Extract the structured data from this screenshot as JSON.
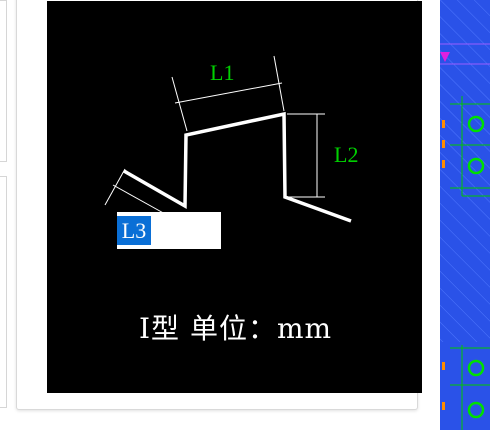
{
  "preview": {
    "dimension_labels": {
      "l1": "L1",
      "l2": "L2",
      "l3": "L3"
    },
    "caption": "I型 单位：mm"
  },
  "colors": {
    "canvas_background": "#000000",
    "dimension_text": "#00d000",
    "selection_highlight": "#0a6fd6",
    "cad_background": "#2a52e8"
  },
  "icons": {
    "cad_markers": "green-circle-icon"
  }
}
